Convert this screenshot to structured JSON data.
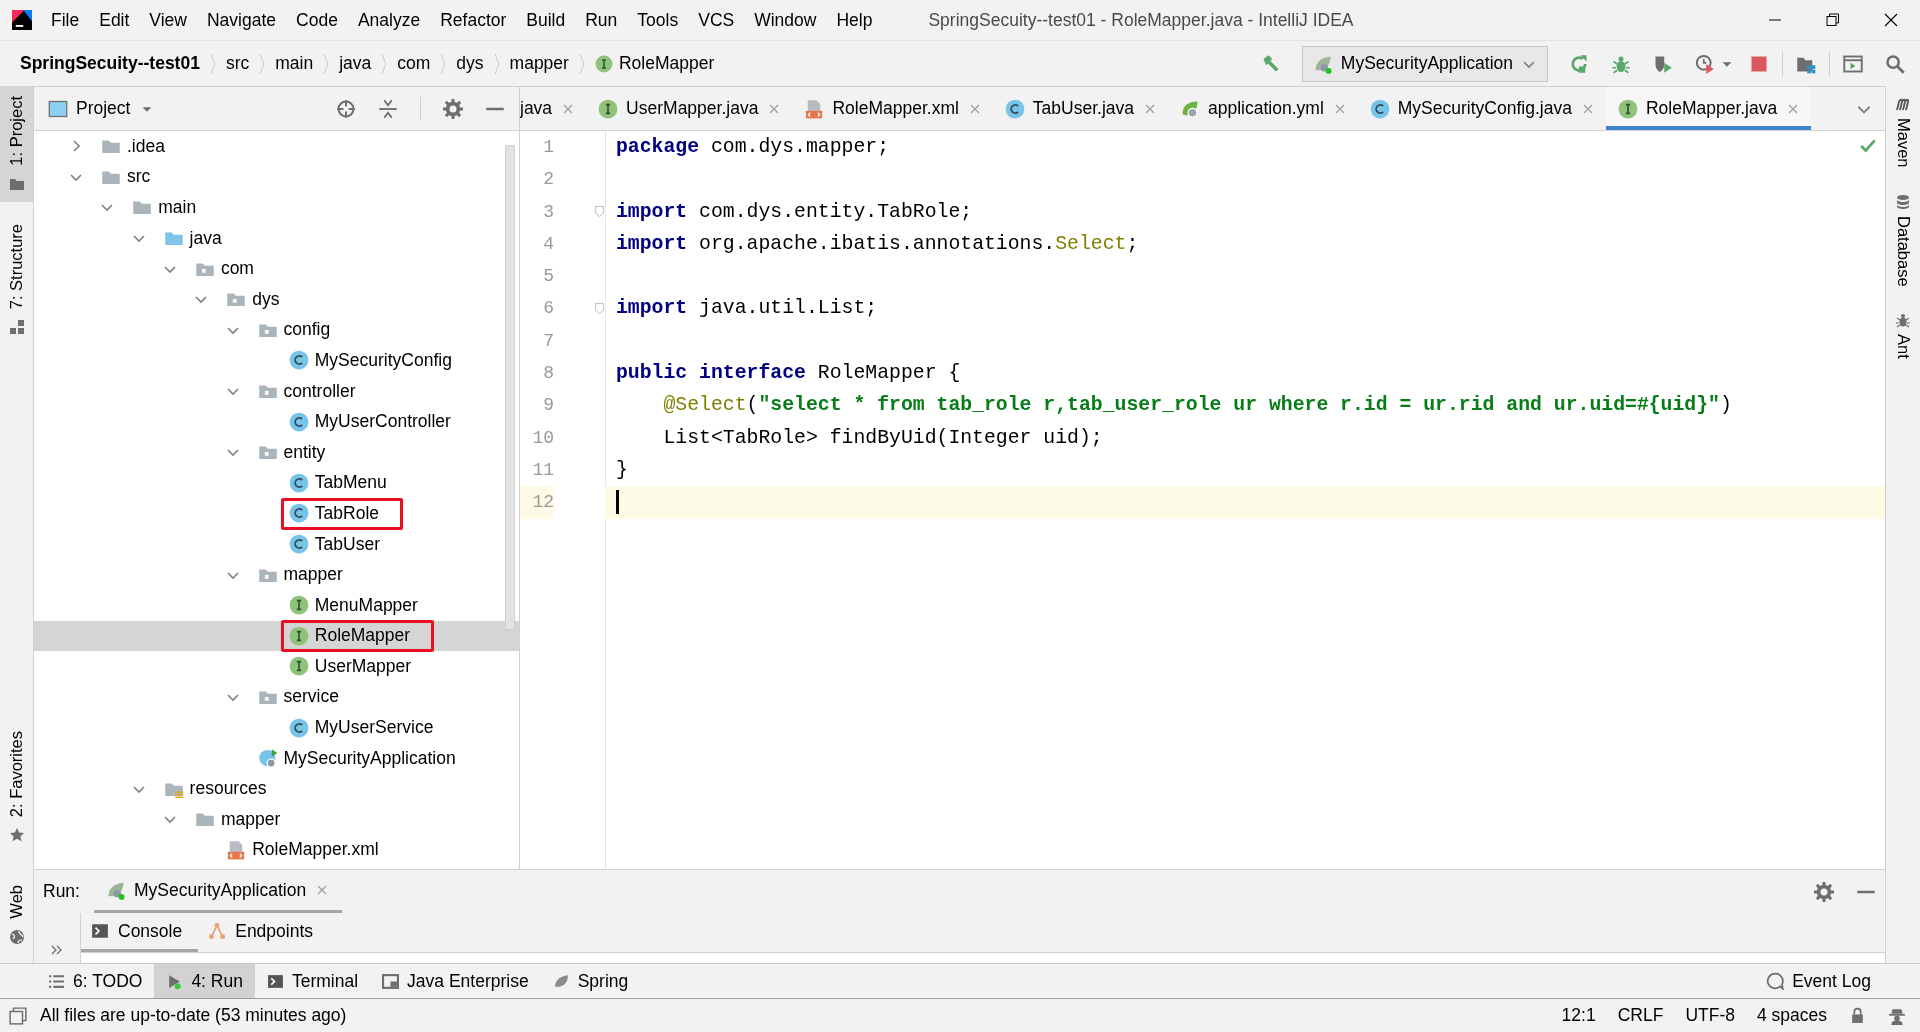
{
  "window": {
    "title": "SpringSecuity--test01 - RoleMapper.java - IntelliJ IDEA"
  },
  "menu": [
    "File",
    "Edit",
    "View",
    "Navigate",
    "Code",
    "Analyze",
    "Refactor",
    "Build",
    "Run",
    "Tools",
    "VCS",
    "Window",
    "Help"
  ],
  "breadcrumbs": [
    {
      "label": "SpringSecuity--test01",
      "kind": "project"
    },
    {
      "label": "src",
      "kind": "folder"
    },
    {
      "label": "main",
      "kind": "folder"
    },
    {
      "label": "java",
      "kind": "folder"
    },
    {
      "label": "com",
      "kind": "folder"
    },
    {
      "label": "dys",
      "kind": "folder"
    },
    {
      "label": "mapper",
      "kind": "folder"
    },
    {
      "label": "RoleMapper",
      "kind": "interface"
    }
  ],
  "run_configuration": {
    "label": "MySecurityApplication"
  },
  "left_stripe": {
    "top": [
      {
        "label": "1: Project",
        "kind": "project",
        "selected": true
      },
      {
        "label": "7: Structure",
        "kind": "structure",
        "selected": false
      }
    ],
    "bottom": [
      {
        "label": "2: Favorites",
        "kind": "favorites",
        "selected": false
      },
      {
        "label": "Web",
        "kind": "web",
        "selected": false
      }
    ]
  },
  "project_panel": {
    "title": "Project",
    "tree": [
      {
        "label": ".idea",
        "kind": "folder",
        "expanded": false,
        "selected": false,
        "boxed": false
      },
      {
        "label": "src",
        "kind": "folder",
        "expanded": true,
        "selected": false,
        "boxed": false,
        "children": [
          {
            "label": "main",
            "kind": "folder",
            "expanded": true,
            "selected": false,
            "boxed": false,
            "children": [
              {
                "label": "java",
                "kind": "source",
                "expanded": true,
                "selected": false,
                "boxed": false,
                "children": [
                  {
                    "label": "com",
                    "kind": "package",
                    "expanded": true,
                    "selected": false,
                    "boxed": false,
                    "children": [
                      {
                        "label": "dys",
                        "kind": "package",
                        "expanded": true,
                        "selected": false,
                        "boxed": false,
                        "children": [
                          {
                            "label": "config",
                            "kind": "package",
                            "expanded": true,
                            "selected": false,
                            "boxed": false,
                            "children": [
                              {
                                "label": "MySecurityConfig",
                                "kind": "class",
                                "selected": false,
                                "boxed": false
                              }
                            ]
                          },
                          {
                            "label": "controller",
                            "kind": "package",
                            "expanded": true,
                            "selected": false,
                            "boxed": false,
                            "children": [
                              {
                                "label": "MyUserController",
                                "kind": "class",
                                "selected": false,
                                "boxed": false
                              }
                            ]
                          },
                          {
                            "label": "entity",
                            "kind": "package",
                            "expanded": true,
                            "selected": false,
                            "boxed": false,
                            "children": [
                              {
                                "label": "TabMenu",
                                "kind": "class",
                                "selected": false,
                                "boxed": false
                              },
                              {
                                "label": "TabRole",
                                "kind": "class",
                                "selected": false,
                                "boxed": true
                              },
                              {
                                "label": "TabUser",
                                "kind": "class",
                                "selected": false,
                                "boxed": false
                              }
                            ]
                          },
                          {
                            "label": "mapper",
                            "kind": "package",
                            "expanded": true,
                            "selected": false,
                            "boxed": false,
                            "children": [
                              {
                                "label": "MenuMapper",
                                "kind": "interface",
                                "selected": false,
                                "boxed": false
                              },
                              {
                                "label": "RoleMapper",
                                "kind": "interface",
                                "selected": true,
                                "boxed": true
                              },
                              {
                                "label": "UserMapper",
                                "kind": "interface",
                                "selected": false,
                                "boxed": false
                              }
                            ]
                          },
                          {
                            "label": "service",
                            "kind": "package",
                            "expanded": true,
                            "selected": false,
                            "boxed": false,
                            "children": [
                              {
                                "label": "MyUserService",
                                "kind": "class",
                                "selected": false,
                                "boxed": false
                              }
                            ]
                          },
                          {
                            "label": "MySecurityApplication",
                            "kind": "application",
                            "selected": false,
                            "boxed": false
                          }
                        ]
                      }
                    ]
                  }
                ]
              },
              {
                "label": "resources",
                "kind": "resources",
                "expanded": true,
                "selected": false,
                "boxed": false,
                "children": [
                  {
                    "label": "mapper",
                    "kind": "folder",
                    "expanded": true,
                    "selected": false,
                    "boxed": false,
                    "children": [
                      {
                        "label": "RoleMapper.xml",
                        "kind": "xml",
                        "selected": false,
                        "boxed": false
                      }
                    ]
                  }
                ]
              }
            ]
          }
        ]
      }
    ]
  },
  "editor_tabs": [
    {
      "label": "java",
      "kind": "none",
      "selected": false
    },
    {
      "label": "UserMapper.java",
      "kind": "interface",
      "selected": false
    },
    {
      "label": "RoleMapper.xml",
      "kind": "xml",
      "selected": false
    },
    {
      "label": "TabUser.java",
      "kind": "class",
      "selected": false
    },
    {
      "label": "application.yml",
      "kind": "yml",
      "selected": false
    },
    {
      "label": "MySecurityConfig.java",
      "kind": "class",
      "selected": false
    },
    {
      "label": "RoleMapper.java",
      "kind": "interface",
      "selected": true
    }
  ],
  "code": {
    "lines": [
      {
        "number": "1",
        "current": false,
        "fold": false,
        "tokens": [
          {
            "text": "package",
            "kind": "keyword"
          },
          {
            "text": " com.dys.mapper;",
            "kind": "plain"
          }
        ]
      },
      {
        "number": "2",
        "current": false,
        "fold": false
      },
      {
        "number": "3",
        "current": false,
        "fold": true,
        "tokens": [
          {
            "text": "import",
            "kind": "keyword"
          },
          {
            "text": " com.dys.entity.TabRole;",
            "kind": "plain"
          }
        ]
      },
      {
        "number": "4",
        "current": false,
        "fold": false,
        "tokens": [
          {
            "text": "import",
            "kind": "keyword"
          },
          {
            "text": " org.apache.ibatis.annotations.",
            "kind": "plain"
          },
          {
            "text": "Select",
            "kind": "annotation"
          },
          {
            "text": ";",
            "kind": "plain"
          }
        ]
      },
      {
        "number": "5",
        "current": false,
        "fold": false
      },
      {
        "number": "6",
        "current": false,
        "fold": true,
        "tokens": [
          {
            "text": "import",
            "kind": "keyword"
          },
          {
            "text": " java.util.List;",
            "kind": "plain"
          }
        ]
      },
      {
        "number": "7",
        "current": false,
        "fold": false
      },
      {
        "number": "8",
        "current": false,
        "fold": false,
        "tokens": [
          {
            "text": "public",
            "kind": "keyword"
          },
          {
            "text": " interface",
            "kind": "keyword"
          },
          {
            "text": " RoleMapper {",
            "kind": "plain"
          }
        ]
      },
      {
        "number": "9",
        "current": false,
        "fold": false,
        "tokens": [
          {
            "text": "    @Select",
            "kind": "annotation"
          },
          {
            "text": "(",
            "kind": "plain"
          },
          {
            "text": "\"select * from tab_role r,tab_user_role ur where r.id = ur.rid and ur.uid=#{uid}\"",
            "kind": "string"
          },
          {
            "text": ")",
            "kind": "plain"
          }
        ]
      },
      {
        "number": "10",
        "current": false,
        "fold": false,
        "tokens": [
          {
            "text": "    List<TabRole> findByUid(Integer uid);",
            "kind": "plain"
          }
        ]
      },
      {
        "number": "11",
        "current": false,
        "fold": false,
        "tokens": [
          {
            "text": "}",
            "kind": "plain"
          }
        ]
      },
      {
        "number": "12",
        "current": true,
        "fold": false
      }
    ]
  },
  "right_stripe": [
    {
      "label": "Maven",
      "kind": "maven"
    },
    {
      "label": "Database",
      "kind": "database"
    },
    {
      "label": "Ant",
      "kind": "ant"
    }
  ],
  "run_panel": {
    "label": "Run:",
    "tabs": [
      {
        "label": "MySecurityApplication",
        "kind": "application",
        "selected": true
      }
    ],
    "subtabs": [
      {
        "label": "Console",
        "kind": "console",
        "selected": true
      },
      {
        "label": "Endpoints",
        "kind": "endpoints",
        "selected": false
      }
    ]
  },
  "tool_buttons": [
    {
      "label": "6: TODO",
      "kind": "todo",
      "selected": false
    },
    {
      "label": "4: Run",
      "kind": "run",
      "selected": true
    },
    {
      "label": "Terminal",
      "kind": "terminal",
      "selected": false
    },
    {
      "label": "Java Enterprise",
      "kind": "enterprise",
      "selected": false
    },
    {
      "label": "Spring",
      "kind": "spring",
      "selected": false
    }
  ],
  "event_log": {
    "label": "Event Log"
  },
  "status_bar": {
    "message": "All files are up-to-date (53 minutes ago)",
    "items": [
      "12:1",
      "CRLF",
      "UTF-8",
      "4 spaces"
    ]
  }
}
